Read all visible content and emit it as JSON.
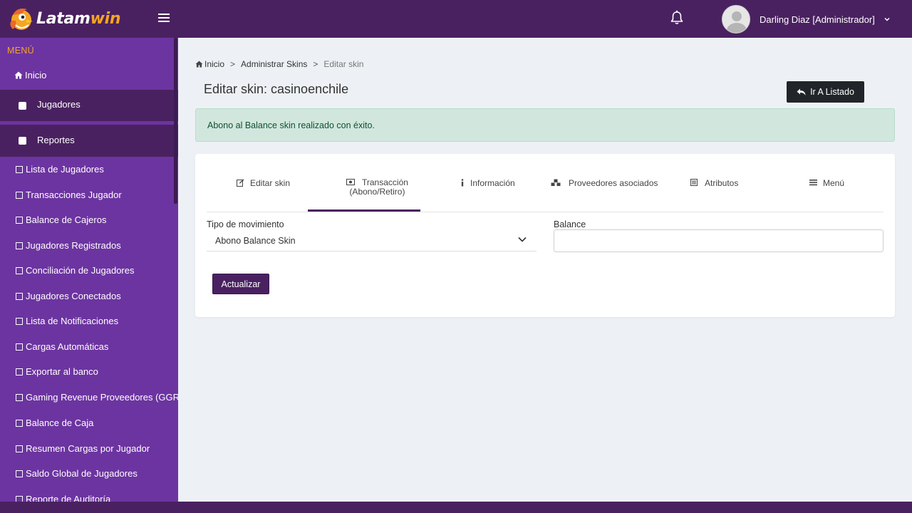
{
  "app": {
    "logo_text_part1": "Latam",
    "logo_text_part2": "win",
    "colors": {
      "primary": "#4a2160",
      "sidebar": "#6c34a0",
      "accent": "#f5a524",
      "success_bg": "#d1e7dd",
      "success_text": "#0f5132"
    }
  },
  "header": {
    "menu_icon": "hamburger-icon",
    "notifications_icon": "bell-icon",
    "user_name": "Darling Diaz [Administrador]"
  },
  "sidebar": {
    "title": "MENÚ",
    "home_label": "Inicio",
    "groups": [
      {
        "label": "Jugadores"
      },
      {
        "label": "Reportes"
      }
    ],
    "items": [
      {
        "label": "Lista de Jugadores"
      },
      {
        "label": "Transacciones Jugador"
      },
      {
        "label": "Balance de Cajeros"
      },
      {
        "label": "Jugadores Registrados"
      },
      {
        "label": "Conciliación de Jugadores"
      },
      {
        "label": "Jugadores Conectados"
      },
      {
        "label": "Lista de Notificaciones"
      },
      {
        "label": "Cargas Automáticas"
      },
      {
        "label": "Exportar al banco"
      },
      {
        "label": "Gaming Revenue Proveedores (GGR)"
      },
      {
        "label": "Balance de Caja"
      },
      {
        "label": "Resumen Cargas por Jugador"
      },
      {
        "label": "Saldo Global de Jugadores"
      },
      {
        "label": "Reporte de Auditoría"
      }
    ]
  },
  "breadcrumb": {
    "home": "Inicio",
    "sep": ">",
    "parent": "Administrar Skins",
    "current": "Editar skin"
  },
  "page": {
    "title": "Editar skin: casinoenchile",
    "back_button": "Ir A Listado",
    "alert": "Abono al Balance skin realizado con éxito."
  },
  "tabs": [
    {
      "label": "Editar skin",
      "icon": "edit-icon"
    },
    {
      "label": "Transacción",
      "label2": "(Abono/Retiro)",
      "icon": "money-icon",
      "active": true
    },
    {
      "label": "Información",
      "icon": "info-icon"
    },
    {
      "label": "Proveedores asociados",
      "icon": "cubes-icon"
    },
    {
      "label": "Atributos",
      "icon": "list-box-icon"
    },
    {
      "label": "Menú",
      "icon": "bars-icon"
    }
  ],
  "form": {
    "tipo_label": "Tipo de movimiento",
    "tipo_value": "Abono Balance Skin",
    "balance_label": "Balance",
    "balance_value": "",
    "submit": "Actualizar"
  }
}
